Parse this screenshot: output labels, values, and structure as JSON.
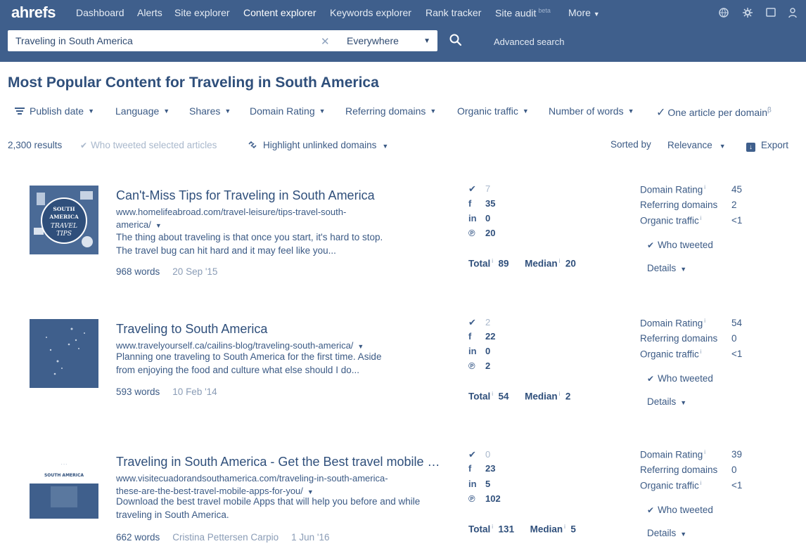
{
  "nav": {
    "logo": "ahrefs",
    "items": [
      "Dashboard",
      "Alerts",
      "Site explorer",
      "Content explorer",
      "Keywords explorer",
      "Rank tracker",
      "Site audit",
      "More"
    ],
    "site_audit_badge": "beta"
  },
  "search": {
    "value": "Traveling in South America",
    "scope": "Everywhere",
    "advanced_label": "Advanced search"
  },
  "title": "Most Popular Content for Traveling in South America",
  "filters": [
    "Publish date",
    "Language",
    "Shares",
    "Domain Rating",
    "Referring domains",
    "Organic traffic",
    "Number of words",
    "One article per domain"
  ],
  "results_bar": {
    "count": "2,300 results",
    "who_tweeted_selected": "Who tweeted selected articles",
    "highlight_unlinked": "Highlight unlinked domains",
    "sorted_by_label": "Sorted by",
    "sort_value": "Relevance",
    "export_label": "Export"
  },
  "labels": {
    "total": "Total",
    "median": "Median",
    "domain_rating": "Domain Rating",
    "referring_domains": "Referring domains",
    "organic_traffic": "Organic traffic",
    "who_tweeted": "Who tweeted",
    "details": "Details"
  },
  "results": [
    {
      "title": "Can't-Miss Tips for Traveling in South America",
      "url_line1": "www.homelifeabroad.com/travel-leisure/tips-travel-south-",
      "url_line2": "america/",
      "desc_line1": "The thing about traveling is that once you start, it's hard to stop.",
      "desc_line2": "The travel bug can hit hard and it may feel like you...",
      "words": "968 words",
      "author": "",
      "date": "20 Sep '15",
      "twitter": "7",
      "facebook": "35",
      "linkedin": "0",
      "pinterest": "20",
      "total": "89",
      "median": "20",
      "domain_rating": "45",
      "referring_domains": "2",
      "organic_traffic": "<1",
      "thumb_text": [
        "SOUTH",
        "AMERICA",
        "TRAVEL",
        "TIPS"
      ]
    },
    {
      "title": "Traveling to South America",
      "url_line1": "www.travelyourself.ca/cailins-blog/traveling-south-america/",
      "url_line2": "",
      "desc_line1": "Planning one traveling to South America for the first time. Aside",
      "desc_line2": "from enjoying the food and culture what else should I do...",
      "words": "593 words",
      "author": "",
      "date": "10 Feb '14",
      "twitter": "2",
      "facebook": "22",
      "linkedin": "0",
      "pinterest": "2",
      "total": "54",
      "median": "2",
      "domain_rating": "54",
      "referring_domains": "0",
      "organic_traffic": "<1",
      "thumb_text": []
    },
    {
      "title": "Traveling in South America - Get the Best travel mobile apps",
      "url_line1": "www.visitecuadorandsouthamerica.com/traveling-in-south-america-",
      "url_line2": "these-are-the-best-travel-mobile-apps-for-you/",
      "desc_line1": "Download the best travel mobile Apps that will help you before and while",
      "desc_line2": "traveling in South America.",
      "words": "662 words",
      "author": "Cristina Pettersen Carpio",
      "date": "1 Jun '16",
      "twitter": "0",
      "facebook": "23",
      "linkedin": "5",
      "pinterest": "102",
      "total": "131",
      "median": "5",
      "domain_rating": "39",
      "referring_domains": "0",
      "organic_traffic": "<1",
      "thumb_text": [
        "SOUTH AMERICA"
      ]
    }
  ]
}
